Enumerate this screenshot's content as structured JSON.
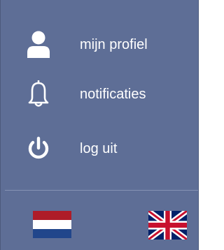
{
  "menu": {
    "items": [
      {
        "label": "mijn profiel",
        "icon": "user-icon"
      },
      {
        "label": "notificaties",
        "icon": "bell-icon"
      },
      {
        "label": "log uit",
        "icon": "power-icon"
      }
    ]
  },
  "languages": [
    {
      "icon": "flag-nl-icon",
      "colors": [
        "#ae1c28",
        "#ffffff",
        "#21468b"
      ]
    },
    {
      "icon": "flag-uk-icon",
      "colors": [
        "#012169",
        "#ffffff",
        "#c8102e"
      ]
    }
  ],
  "colors": {
    "background": "#5e6e96",
    "text": "#ffffff",
    "divider": "#8593b4"
  }
}
